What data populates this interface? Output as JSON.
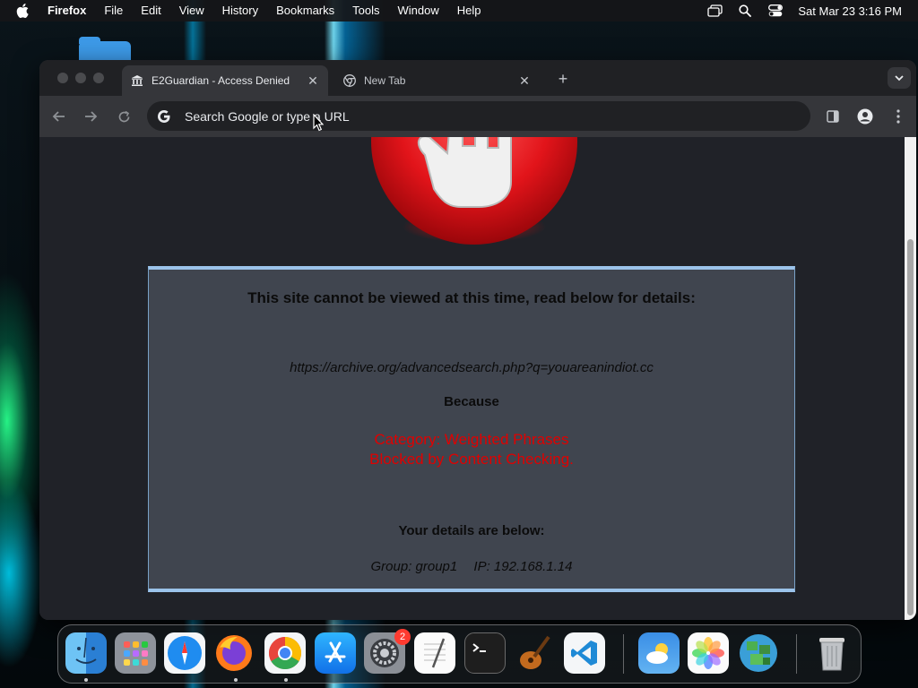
{
  "menubar": {
    "app_name": "Firefox",
    "items": [
      "File",
      "Edit",
      "View",
      "History",
      "Bookmarks",
      "Tools",
      "Window",
      "Help"
    ],
    "clock": "Sat Mar 23  3:16 PM",
    "status_icons": [
      "screen-mirroring-icon",
      "spotlight-search-icon",
      "control-center-icon"
    ]
  },
  "browser": {
    "tabs": [
      {
        "title": "E2Guardian - Access Denied",
        "favicon": "bank-icon",
        "active": true
      },
      {
        "title": "New Tab",
        "favicon": "chrome-icon",
        "active": false
      }
    ],
    "omnibox": {
      "placeholder": "Search Google or type a URL"
    }
  },
  "page": {
    "heading": "This site cannot be viewed at this time, read below for details:",
    "blocked_url": "https://archive.org/advancedsearch.php?q=youareanindiot.cc",
    "because": "Because",
    "reason_category": "Category: Weighted Phrases",
    "reason_detail": "Blocked by Content Checking.",
    "details_heading": "Your details are below:",
    "group": "Group: group1",
    "ip": "IP: 192.168.1.14",
    "colors": {
      "reason": "#e00000",
      "panel": "#40454f",
      "panel_border": "#9bc3ea"
    }
  },
  "dock": {
    "apps": [
      "finder-icon",
      "launchpad-icon",
      "safari-icon",
      "firefox-icon",
      "chrome-icon",
      "app-store-icon",
      "system-settings-icon",
      "textedit-icon",
      "terminal-icon",
      "garageband-icon",
      "vscode-icon",
      "weather-icon",
      "photos-icon",
      "minecraft-icon",
      "trash-icon"
    ],
    "badge_count": "2"
  }
}
